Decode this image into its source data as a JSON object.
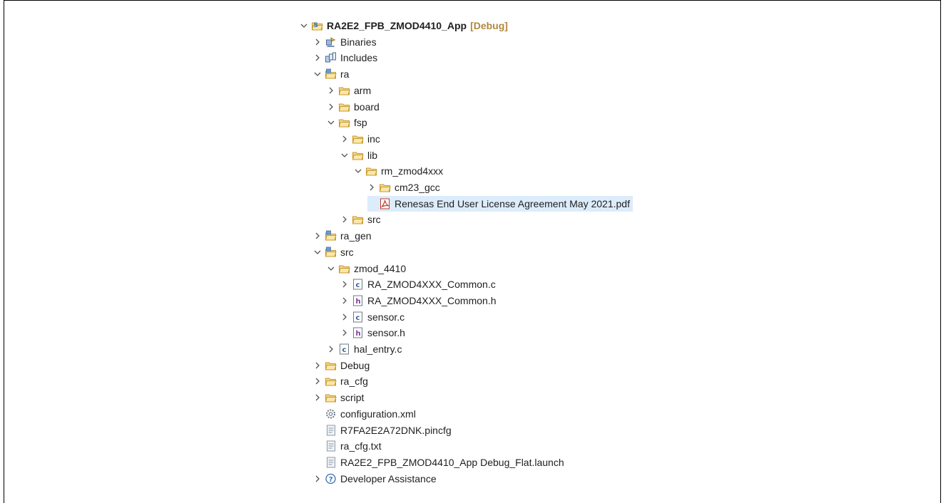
{
  "tree": [
    {
      "depth": 0,
      "expander": "expanded",
      "icon": "project-icon",
      "label": "RA2E2_FPB_ZMOD4410_App",
      "badge": "[Debug]",
      "bold": true
    },
    {
      "depth": 1,
      "expander": "collapsed",
      "icon": "binaries-icon",
      "label": "Binaries"
    },
    {
      "depth": 1,
      "expander": "collapsed",
      "icon": "includes-icon",
      "label": "Includes"
    },
    {
      "depth": 1,
      "expander": "expanded",
      "icon": "source-folder-icon",
      "label": "ra"
    },
    {
      "depth": 2,
      "expander": "collapsed",
      "icon": "folder-icon",
      "label": "arm"
    },
    {
      "depth": 2,
      "expander": "collapsed",
      "icon": "folder-icon",
      "label": "board"
    },
    {
      "depth": 2,
      "expander": "expanded",
      "icon": "folder-icon",
      "label": "fsp"
    },
    {
      "depth": 3,
      "expander": "collapsed",
      "icon": "folder-icon",
      "label": "inc"
    },
    {
      "depth": 3,
      "expander": "expanded",
      "icon": "folder-icon",
      "label": "lib"
    },
    {
      "depth": 4,
      "expander": "expanded",
      "icon": "folder-icon",
      "label": "rm_zmod4xxx"
    },
    {
      "depth": 5,
      "expander": "collapsed",
      "icon": "folder-icon",
      "label": "cm23_gcc"
    },
    {
      "depth": 5,
      "expander": "none",
      "icon": "pdf-icon",
      "label": "Renesas End User License Agreement May 2021.pdf",
      "selected": true
    },
    {
      "depth": 3,
      "expander": "collapsed",
      "icon": "folder-icon",
      "label": "src"
    },
    {
      "depth": 1,
      "expander": "collapsed",
      "icon": "source-folder-icon",
      "label": "ra_gen"
    },
    {
      "depth": 1,
      "expander": "expanded",
      "icon": "source-folder-icon",
      "label": "src"
    },
    {
      "depth": 2,
      "expander": "expanded",
      "icon": "folder-icon",
      "label": "zmod_4410"
    },
    {
      "depth": 3,
      "expander": "collapsed",
      "icon": "c-file-icon",
      "label": "RA_ZMOD4XXX_Common.c"
    },
    {
      "depth": 3,
      "expander": "collapsed",
      "icon": "h-file-icon",
      "label": "RA_ZMOD4XXX_Common.h"
    },
    {
      "depth": 3,
      "expander": "collapsed",
      "icon": "c-file-icon",
      "label": "sensor.c"
    },
    {
      "depth": 3,
      "expander": "collapsed",
      "icon": "h-file-icon",
      "label": "sensor.h"
    },
    {
      "depth": 2,
      "expander": "collapsed",
      "icon": "c-file-icon",
      "label": "hal_entry.c"
    },
    {
      "depth": 1,
      "expander": "collapsed",
      "icon": "folder-icon",
      "label": "Debug"
    },
    {
      "depth": 1,
      "expander": "collapsed",
      "icon": "folder-icon",
      "label": "ra_cfg"
    },
    {
      "depth": 1,
      "expander": "collapsed",
      "icon": "folder-icon",
      "label": "script"
    },
    {
      "depth": 1,
      "expander": "none",
      "icon": "config-gear-icon",
      "label": "configuration.xml"
    },
    {
      "depth": 1,
      "expander": "none",
      "icon": "text-file-icon",
      "label": "R7FA2E2A72DNK.pincfg"
    },
    {
      "depth": 1,
      "expander": "none",
      "icon": "text-file-icon",
      "label": "ra_cfg.txt"
    },
    {
      "depth": 1,
      "expander": "none",
      "icon": "text-file-icon",
      "label": "RA2E2_FPB_ZMOD4410_App Debug_Flat.launch"
    },
    {
      "depth": 1,
      "expander": "collapsed",
      "icon": "help-icon",
      "label": "Developer Assistance"
    }
  ]
}
